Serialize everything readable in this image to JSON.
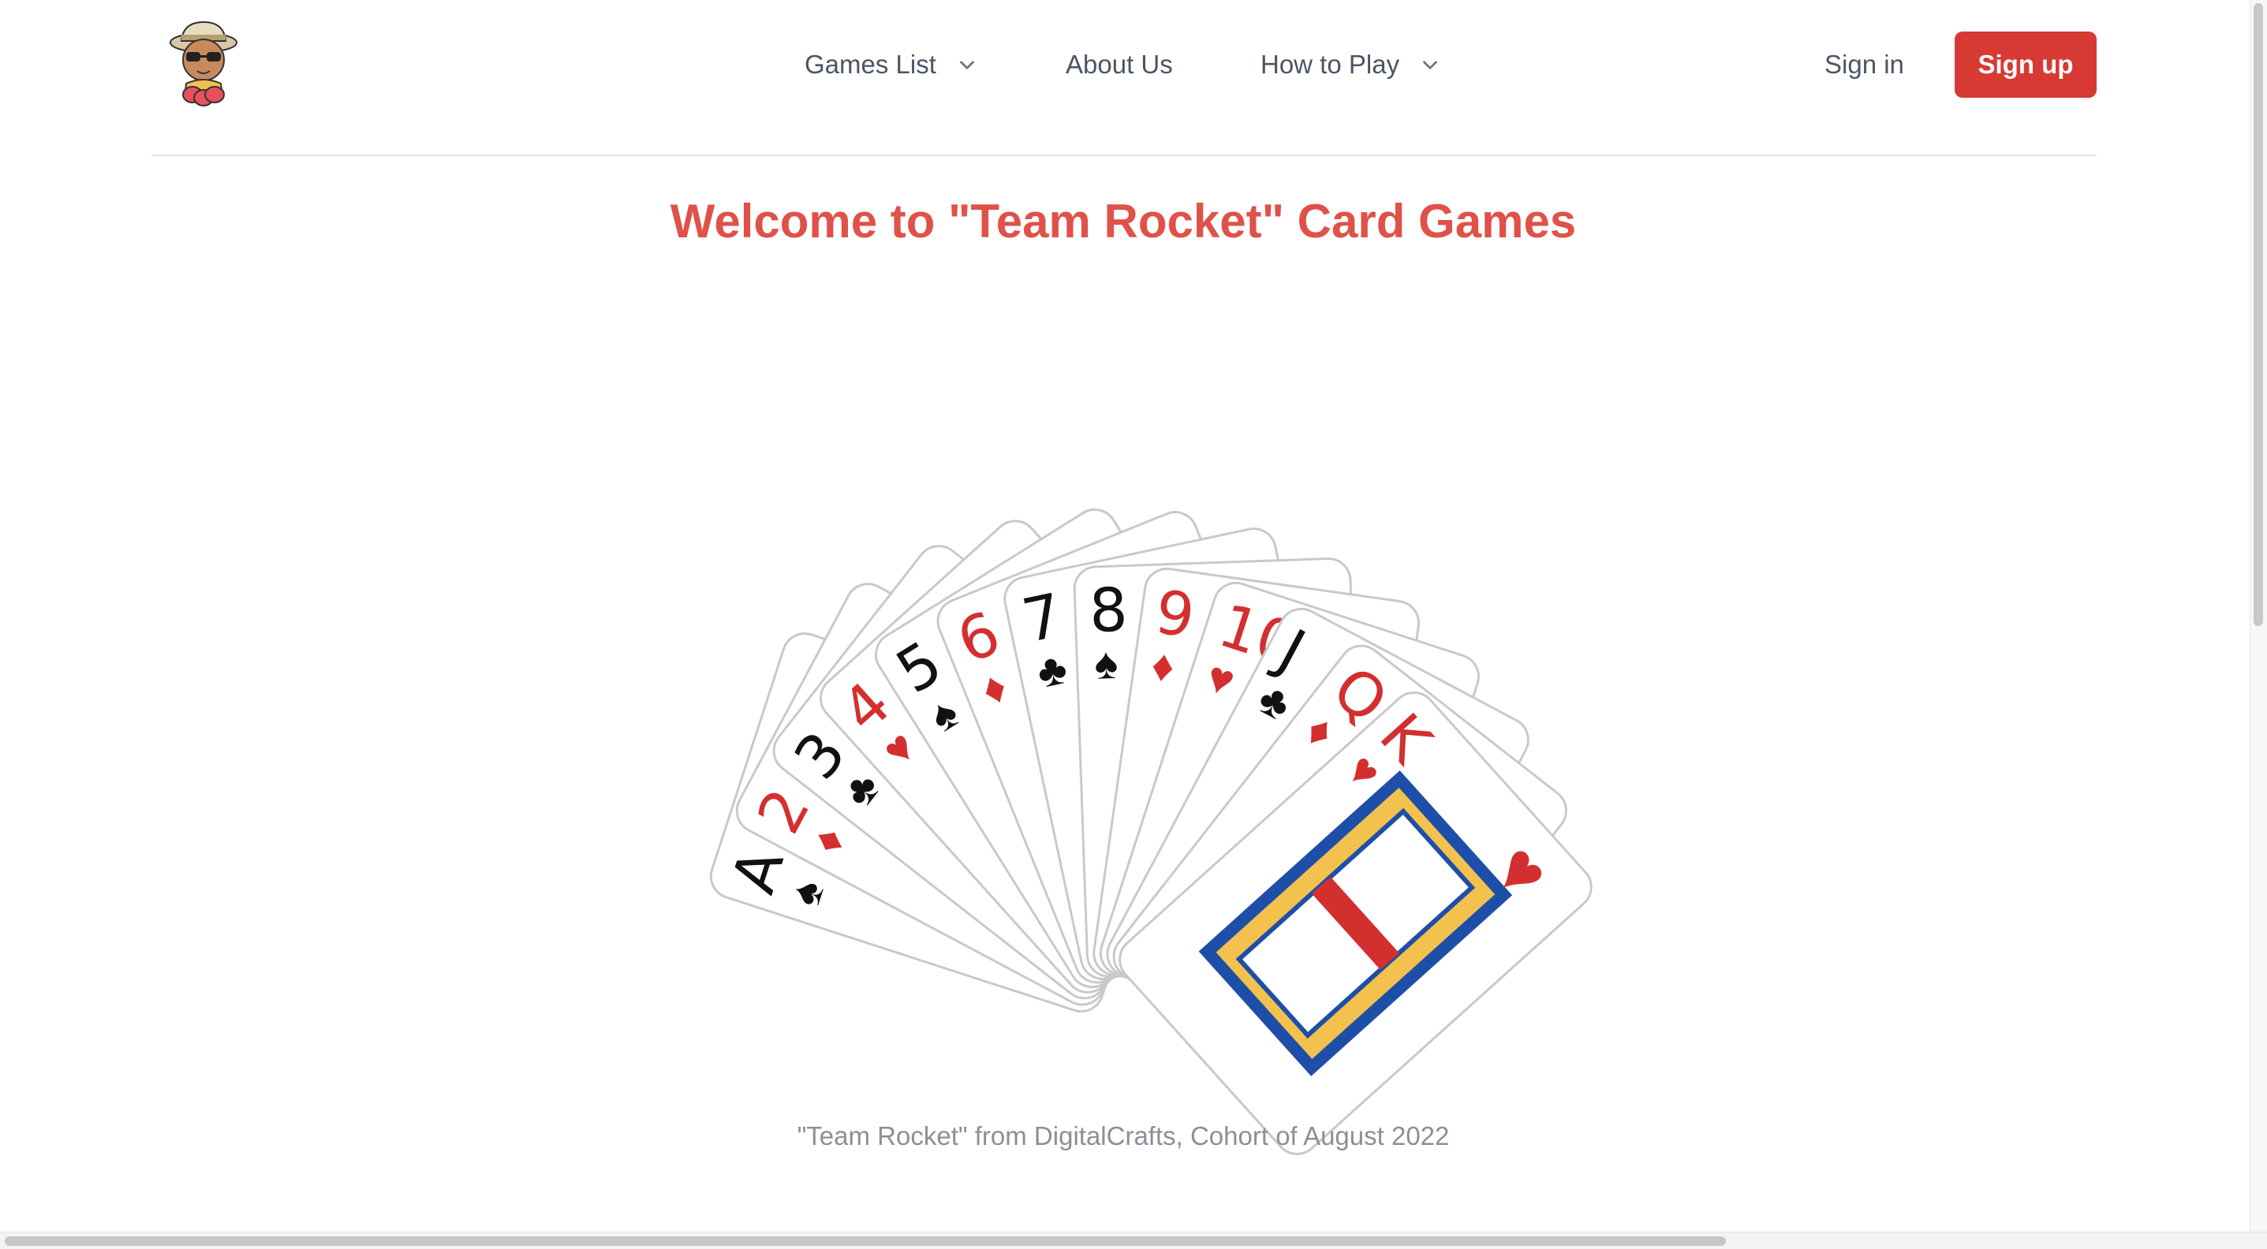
{
  "header": {
    "logo_alt": "Team Rocket mascot",
    "nav": [
      {
        "label": "Games List",
        "has_dropdown": true
      },
      {
        "label": "About Us",
        "has_dropdown": false
      },
      {
        "label": "How to Play",
        "has_dropdown": true
      }
    ],
    "sign_in": "Sign in",
    "sign_up": "Sign up"
  },
  "main": {
    "title": "Welcome to \"Team Rocket\" Card Games",
    "cards": [
      {
        "rank": "A",
        "suit": "♠",
        "color": "black"
      },
      {
        "rank": "2",
        "suit": "♦",
        "color": "red"
      },
      {
        "rank": "3",
        "suit": "♣",
        "color": "black"
      },
      {
        "rank": "4",
        "suit": "♥",
        "color": "red"
      },
      {
        "rank": "5",
        "suit": "♠",
        "color": "black"
      },
      {
        "rank": "6",
        "suit": "♦",
        "color": "red"
      },
      {
        "rank": "7",
        "suit": "♣",
        "color": "black"
      },
      {
        "rank": "8",
        "suit": "♠",
        "color": "black"
      },
      {
        "rank": "9",
        "suit": "♦",
        "color": "red"
      },
      {
        "rank": "10",
        "suit": "♥",
        "color": "red"
      },
      {
        "rank": "J",
        "suit": "♣",
        "color": "black"
      },
      {
        "rank": "Q",
        "suit": "♦",
        "color": "red"
      },
      {
        "rank": "K",
        "suit": "♥",
        "color": "red"
      }
    ]
  },
  "footer": {
    "text": "\"Team Rocket\" from DigitalCrafts, Cohort of August 2022"
  },
  "colors": {
    "brand_red": "#d63a33",
    "title_red": "#e05148",
    "nav_text": "#4b5563",
    "footer_text": "#8b8f97"
  },
  "icons": [
    "chevron-down-icon",
    "mascot-logo"
  ]
}
